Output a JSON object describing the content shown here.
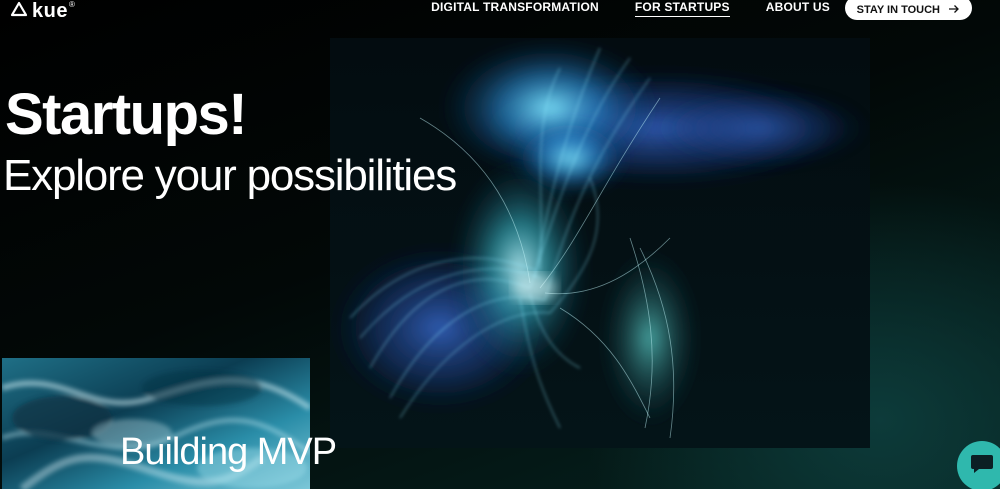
{
  "header": {
    "logo_text": "kue",
    "logo_mark": "®",
    "nav": [
      {
        "label": "DIGITAL TRANSFORMATION",
        "active": false
      },
      {
        "label": "FOR STARTUPS",
        "active": true
      },
      {
        "label": "ABOUT US",
        "active": false
      }
    ],
    "cta_label": "STAY IN TOUCH",
    "cta_icon": "arrow-right-icon"
  },
  "hero": {
    "title": "Startups!",
    "subtitle": "Explore your possibilities",
    "art_icon": "fiber-optic-light-image"
  },
  "card": {
    "label": "Building MVP",
    "image": "marble-texture-image"
  },
  "chat": {
    "icon": "chat-bubble-icon",
    "color": "#2fb8ad"
  },
  "colors": {
    "background": "#03110f",
    "accent": "#2fb8ad",
    "text": "#ffffff"
  }
}
